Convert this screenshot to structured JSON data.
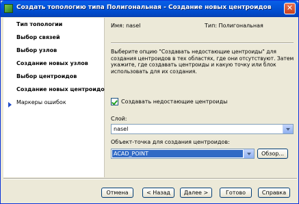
{
  "window": {
    "title": "Создать топологию типа Полигональная - Создание новых центроидов",
    "close_symbol": "✕"
  },
  "nav": {
    "items": [
      {
        "label": "Тип топологии"
      },
      {
        "label": "Выбор связей"
      },
      {
        "label": "Выбор узлов"
      },
      {
        "label": "Создание новых узлов"
      },
      {
        "label": "Выбор центроидов"
      },
      {
        "label": "Создание новых центроидов"
      },
      {
        "label": "Маркеры ошибок"
      }
    ],
    "current_index": 5
  },
  "info": {
    "name": "Имя: nasel",
    "type": "Тип: Полигональная"
  },
  "description": "Выберите опцию \"Создавать недостающие центроиды\" для создания центроидов в тех областях, где они отсутствуют. Затем укажите, где создавать центроиды и какую точку или блок использовать для их создания.",
  "create_missing": {
    "label": "Создавать недостающие центроиды",
    "checked": true
  },
  "layer": {
    "label": "Слой:",
    "value": "nasel"
  },
  "point_object": {
    "label": "Объект-точка для создания центроидов:",
    "value": "ACAD_POINT",
    "browse_label": "Обзор..."
  },
  "footer": {
    "cancel": "Отмена",
    "back": "< Назад",
    "next": "Далее >",
    "finish": "Готово",
    "help": "Справка"
  },
  "colors": {
    "titlebar": "#0054e3",
    "selection": "#316ac5",
    "nav_arrow": "#2550c8"
  }
}
